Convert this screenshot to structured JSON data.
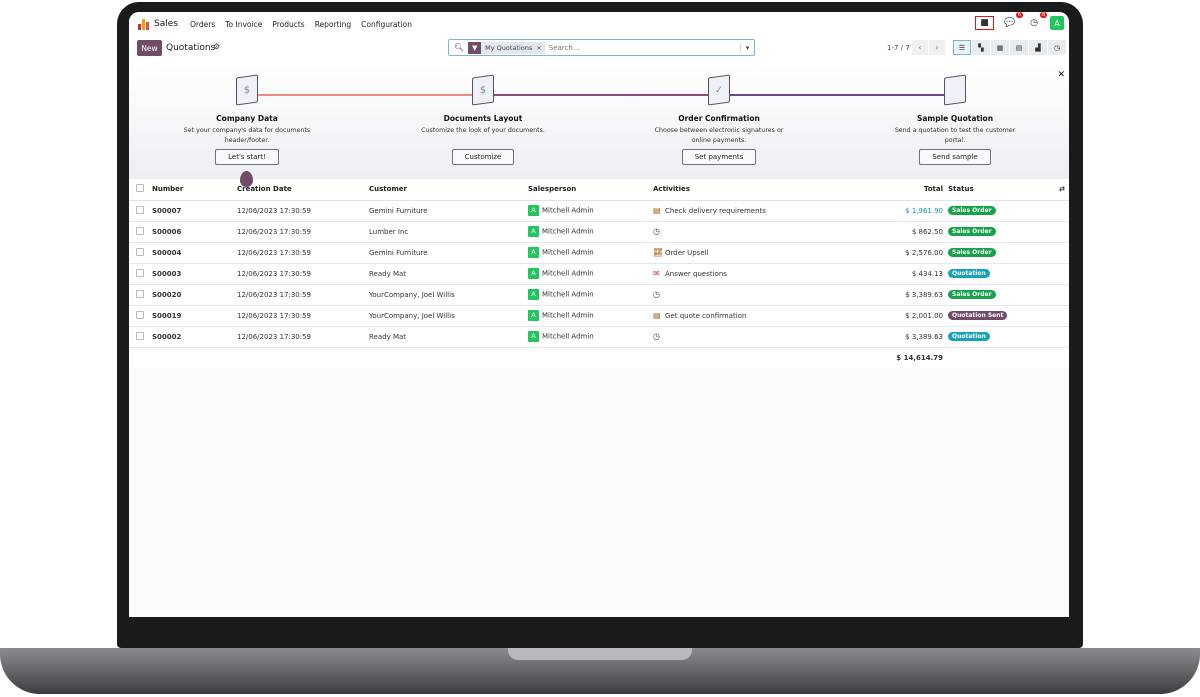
{
  "topbar": {
    "app": "Sales",
    "menu": [
      "Orders",
      "To Invoice",
      "Products",
      "Reporting",
      "Configuration"
    ],
    "messages_count": "6",
    "activities_count": "8",
    "avatar": "A"
  },
  "control": {
    "new_label": "New",
    "title": "Quotations",
    "facet": "My Quotations",
    "search_placeholder": "Search...",
    "pager": "1-7 / 7"
  },
  "onboarding": [
    {
      "title": "Company Data",
      "desc": "Set your company's data for documents header/footer.",
      "button": "Let's start!"
    },
    {
      "title": "Documents Layout",
      "desc": "Customize the look of your documents.",
      "button": "Customize"
    },
    {
      "title": "Order Confirmation",
      "desc": "Choose between electronic signatures or online payments.",
      "button": "Set payments"
    },
    {
      "title": "Sample Quotation",
      "desc": "Send a quotation to test the customer portal.",
      "button": "Send sample"
    }
  ],
  "table": {
    "headers": [
      "Number",
      "Creation Date",
      "Customer",
      "Salesperson",
      "Activities",
      "Total",
      "Status"
    ],
    "rows": [
      {
        "number": "S00007",
        "date": "12/06/2023 17:30:59",
        "customer": "Gemini Furniture",
        "salesperson": "Mitchell Admin",
        "activity": "Check delivery requirements",
        "activity_icon": "task-icon",
        "total": "$ 1,961.90",
        "status": "Sales Order"
      },
      {
        "number": "S00006",
        "date": "12/06/2023 17:30:59",
        "customer": "Lumber Inc",
        "salesperson": "Mitchell Admin",
        "activity": "",
        "activity_icon": "clock-icon",
        "total": "$ 862.50",
        "status": "Sales Order"
      },
      {
        "number": "S00004",
        "date": "12/06/2023 17:30:59",
        "customer": "Gemini Furniture",
        "salesperson": "Mitchell Admin",
        "activity": "Order Upsell",
        "activity_icon": "chart-icon",
        "total": "$ 2,576.00",
        "status": "Sales Order"
      },
      {
        "number": "S00003",
        "date": "12/06/2023 17:30:59",
        "customer": "Ready Mat",
        "salesperson": "Mitchell Admin",
        "activity": "Answer questions",
        "activity_icon": "email-icon",
        "total": "$ 434.13",
        "status": "Quotation"
      },
      {
        "number": "S00020",
        "date": "12/06/2023 17:30:59",
        "customer": "YourCompany, Joel Willis",
        "salesperson": "Mitchell Admin",
        "activity": "",
        "activity_icon": "clock-icon",
        "total": "$ 3,389.63",
        "status": "Sales Order"
      },
      {
        "number": "S00019",
        "date": "12/06/2023 17:30:59",
        "customer": "YourCompany, Joel Willis",
        "salesperson": "Mitchell Admin",
        "activity": "Get quote confirmation",
        "activity_icon": "task-icon",
        "total": "$ 2,001.00",
        "status": "Quotation Sent"
      },
      {
        "number": "S00002",
        "date": "12/06/2023 17:30:59",
        "customer": "Ready Mat",
        "salesperson": "Mitchell Admin",
        "activity": "",
        "activity_icon": "clock-icon",
        "total": "$ 3,389.63",
        "status": "Quotation"
      }
    ],
    "grand_total": "$ 14,614.79"
  },
  "colors": {
    "brand": "#714b67",
    "sales_order": "#16a34a",
    "quotation": "#17a2b8",
    "quotation_sent": "#714b67",
    "link": "#017e84"
  }
}
